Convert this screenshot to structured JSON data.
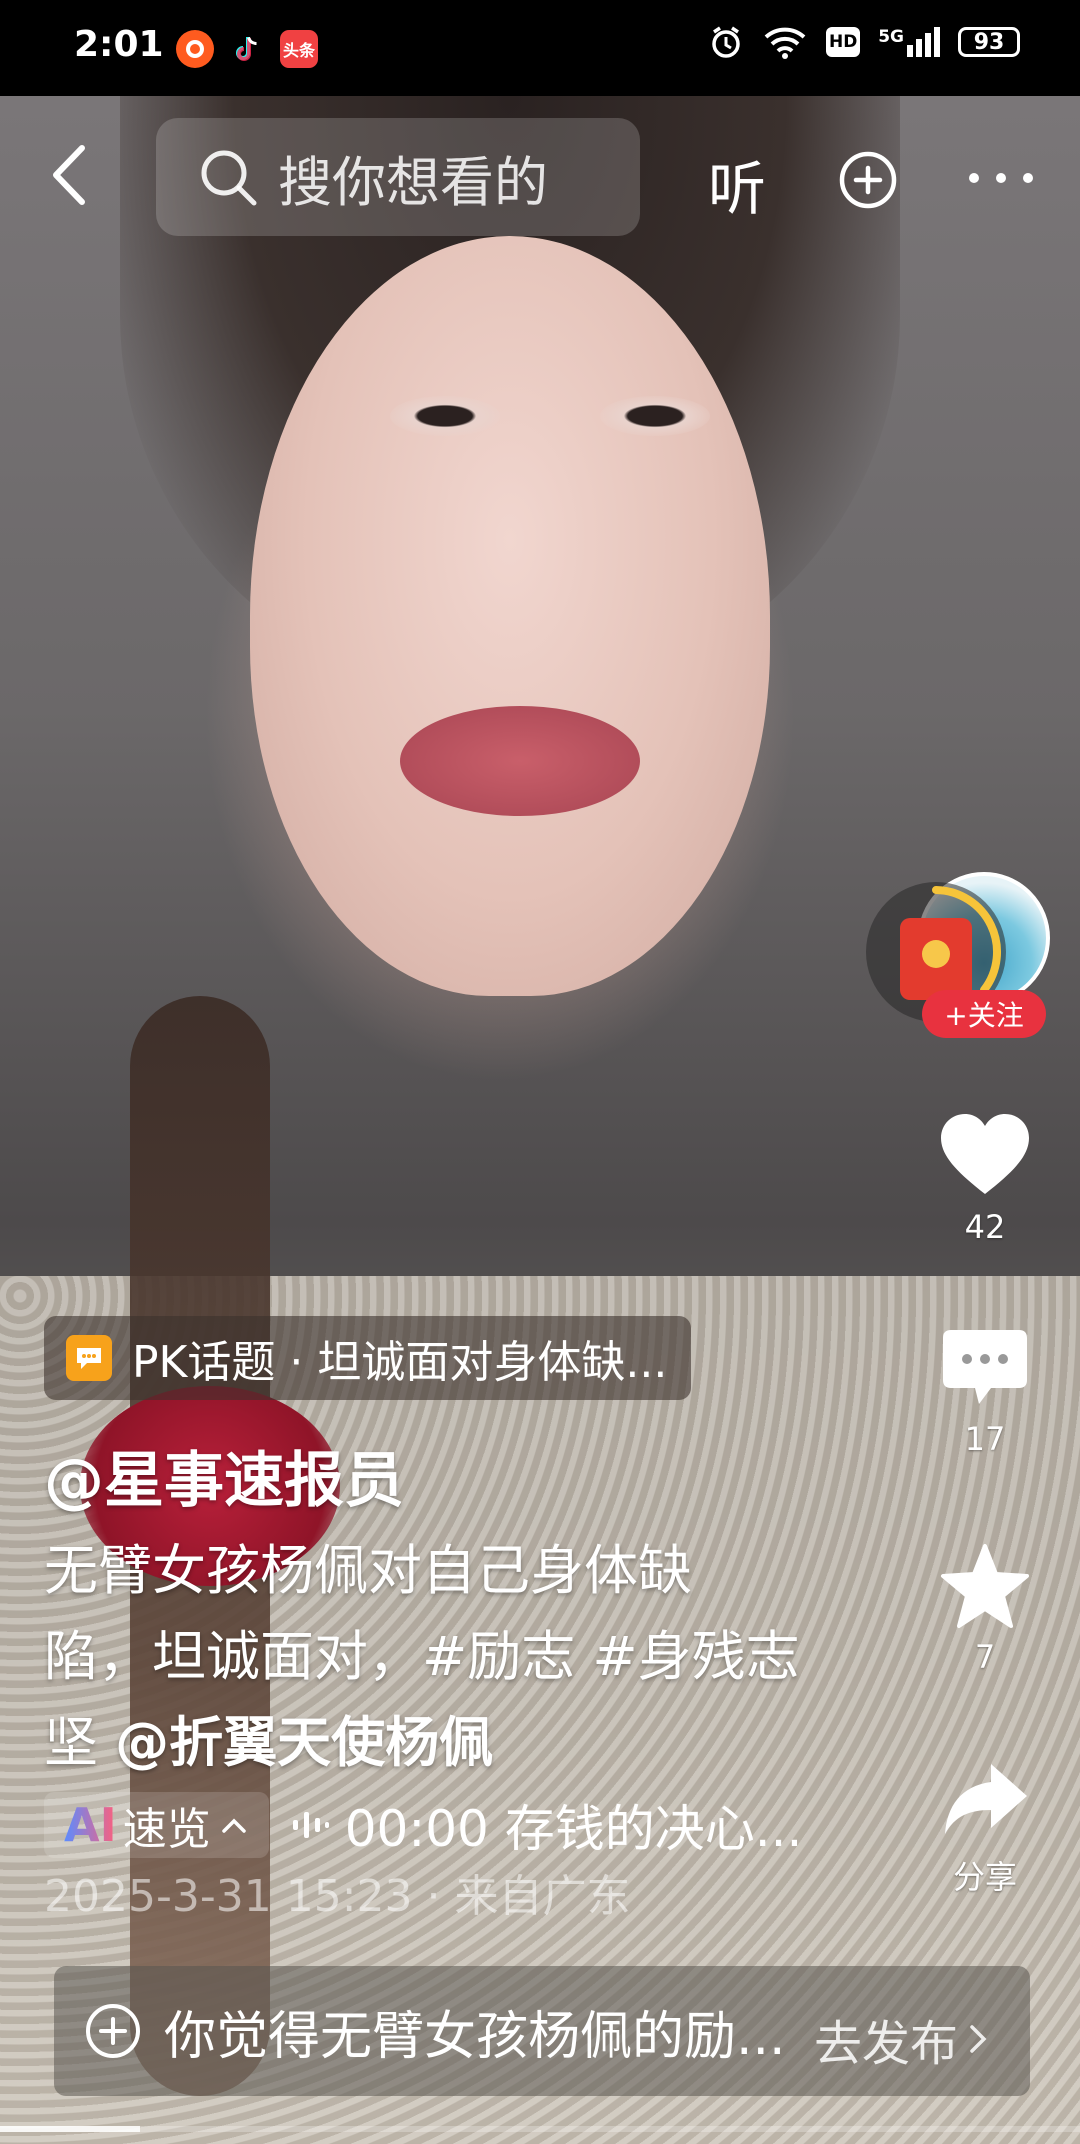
{
  "status_bar": {
    "time": "2:01",
    "apps": [
      "头条"
    ],
    "battery": "93",
    "network": "5G",
    "hd": "HD"
  },
  "nav": {
    "search_placeholder": "搜你想看的",
    "listen_label": "听"
  },
  "actions": {
    "follow_label": "+关注",
    "like_count": "42",
    "comment_count": "17",
    "favorite_count": "7",
    "share_label": "分享"
  },
  "post": {
    "topic": "PK话题 · 坦诚面对身体缺...",
    "author": "@星事速报员",
    "desc_line1": "无臂女孩杨佩对自己身体缺",
    "desc_line2": "陷，坦诚面对，#励志 #身残志",
    "desc_line3_prefix": "坚 ",
    "desc_mention": "@折翼天使杨佩",
    "ai_mark": "AI",
    "ai_label": "速览",
    "audio_text": "00:00 存钱的决心...",
    "timestamp": "2025-3-31 15:23 · 来自广东"
  },
  "publish": {
    "prompt": "你觉得无臂女孩杨佩的励...",
    "go_label": "去发布"
  },
  "playback": {
    "progress_fraction": 0.13
  },
  "colors": {
    "follow_red": "#e8323f",
    "topic_orange": "#f7a21b",
    "redpacket_red": "#e33b2e"
  },
  "icons": [
    "back-icon",
    "search-icon",
    "plus-circle-icon",
    "more-icon",
    "heart-icon",
    "comment-icon",
    "star-icon",
    "share-icon",
    "red-packet-icon",
    "audio-wave-icon",
    "chevron-up-icon",
    "chevron-right-icon"
  ]
}
